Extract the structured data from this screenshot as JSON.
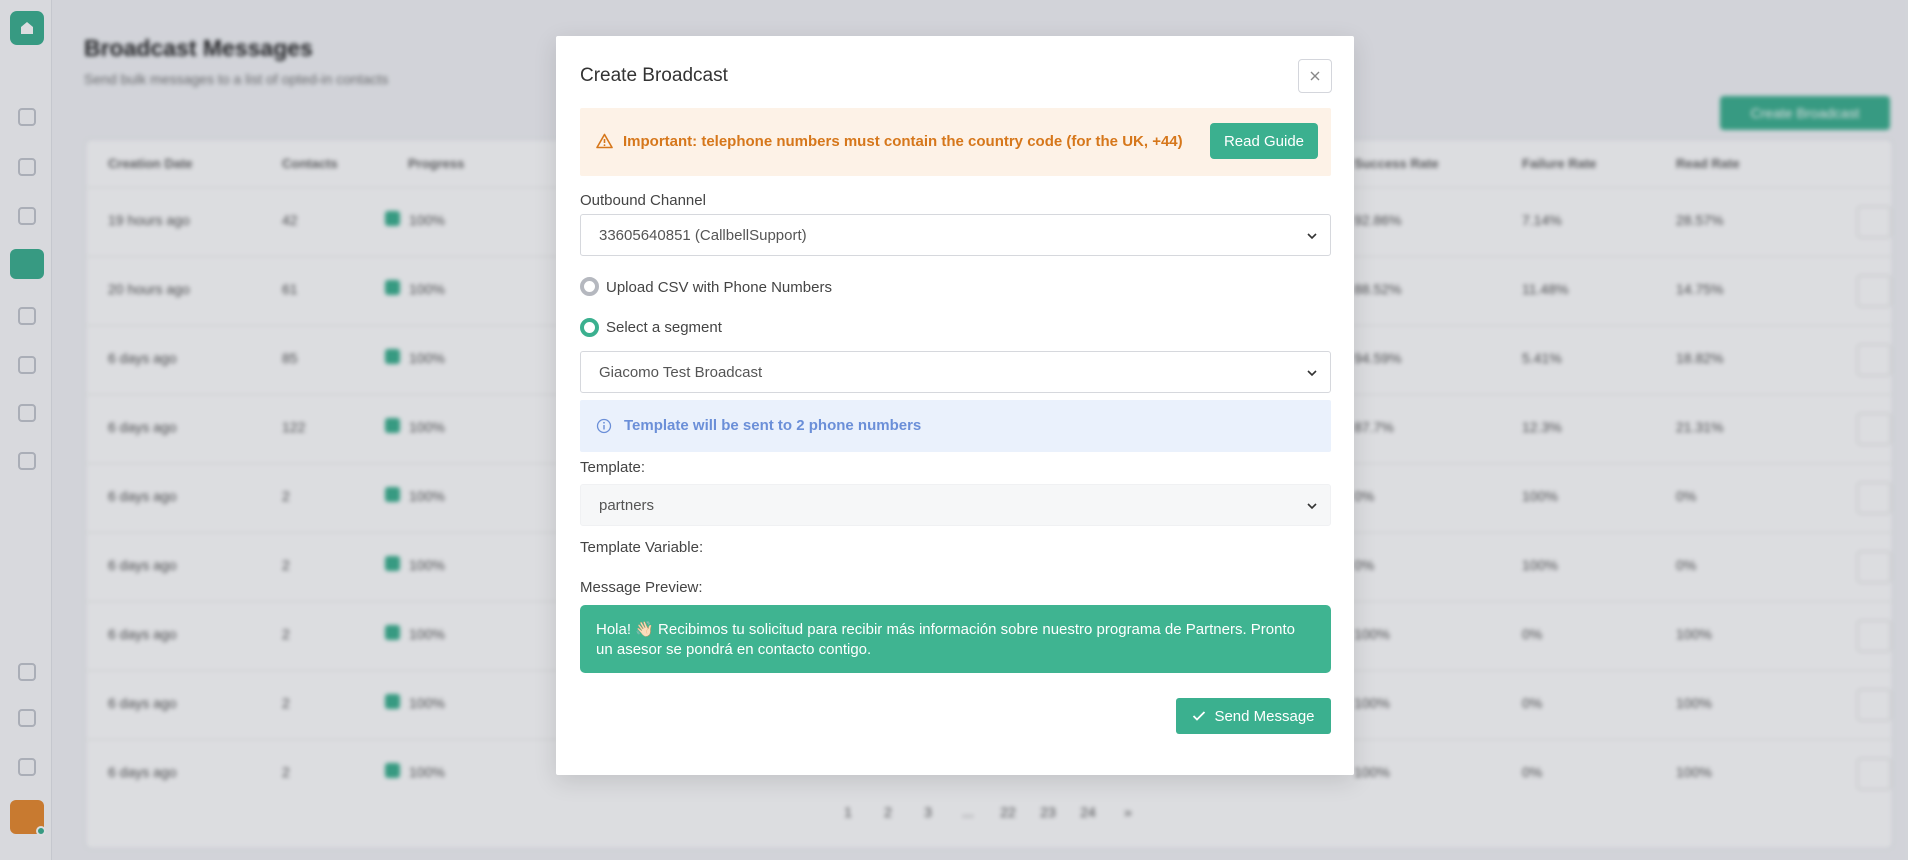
{
  "background": {
    "page_title": "Broadcast Messages",
    "page_subtitle": "Send bulk messages to a list of opted-in contacts",
    "create_button": "Create Broadcast",
    "columns": [
      "Creation Date",
      "Contacts",
      "Progress",
      "Success Rate",
      "Failure Rate",
      "Read Rate"
    ],
    "rows": [
      {
        "date": "19 hours ago",
        "contacts": "42",
        "progress": "100%",
        "success": "92.86%",
        "failure": "7.14%",
        "read": "28.57%"
      },
      {
        "date": "20 hours ago",
        "contacts": "61",
        "progress": "100%",
        "success": "88.52%",
        "failure": "11.48%",
        "read": "14.75%"
      },
      {
        "date": "6 days ago",
        "contacts": "85",
        "progress": "100%",
        "success": "94.59%",
        "failure": "5.41%",
        "read": "18.82%"
      },
      {
        "date": "6 days ago",
        "contacts": "122",
        "progress": "100%",
        "success": "87.7%",
        "failure": "12.3%",
        "read": "21.31%"
      },
      {
        "date": "6 days ago",
        "contacts": "2",
        "progress": "100%",
        "success": "0%",
        "failure": "100%",
        "read": "0%"
      },
      {
        "date": "6 days ago",
        "contacts": "2",
        "progress": "100%",
        "success": "0%",
        "failure": "100%",
        "read": "0%"
      },
      {
        "date": "6 days ago",
        "contacts": "2",
        "progress": "100%",
        "success": "100%",
        "failure": "0%",
        "read": "100%"
      },
      {
        "date": "6 days ago",
        "contacts": "2",
        "progress": "100%",
        "success": "100%",
        "failure": "0%",
        "read": "100%"
      },
      {
        "date": "6 days ago",
        "contacts": "2",
        "progress": "100%",
        "success": "100%",
        "failure": "0%",
        "read": "100%"
      }
    ],
    "pagination": [
      "1",
      "2",
      "3",
      "...",
      "22",
      "23",
      "24",
      "»"
    ]
  },
  "modal": {
    "title": "Create Broadcast",
    "warning_text": "Important: telephone numbers must contain the country code (for the UK, +44)",
    "read_guide": "Read Guide",
    "outbound_label": "Outbound Channel",
    "outbound_value": "33605640851 (CallbellSupport)",
    "radio_csv": "Upload CSV with Phone Numbers",
    "radio_segment": "Select a segment",
    "segment_value": "Giacomo Test Broadcast",
    "info_text": "Template will be sent to 2 phone numbers",
    "template_label": "Template:",
    "template_value": "partners",
    "variable_label": "Template Variable:",
    "preview_label": "Message Preview:",
    "preview_text": "Hola! 👋🏻 Recibimos tu solicitud para recibir más información sobre nuestro programa de Partners. Pronto un asesor se pondrá en contacto contigo.",
    "send_button": "Send Message"
  },
  "colors": {
    "accent": "#3bb08f",
    "warning_bg": "#fdf2e7",
    "warning_text": "#d6771b",
    "info_bg": "#eaf1fc",
    "info_text": "#6b8fd8"
  }
}
